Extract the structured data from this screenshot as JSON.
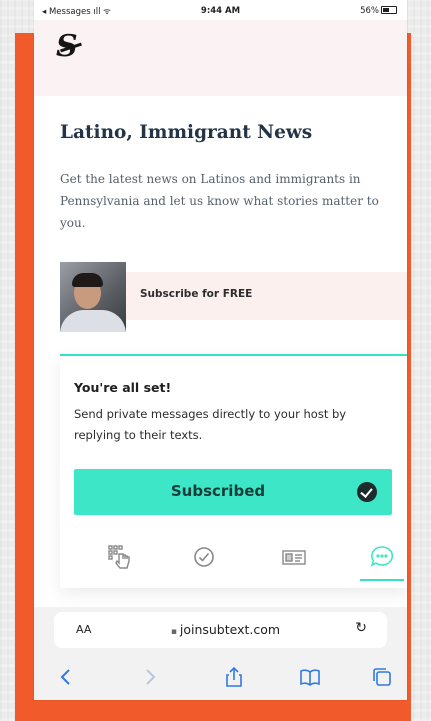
{
  "status_bar": {
    "carrier": "◂ Messages",
    "time": "9:44 AM",
    "battery": "56%"
  },
  "page": {
    "logo": "S",
    "title": "Latino, Immigrant News",
    "description": "Get the latest news on Latinos and immigrants in Pennsylvania and let us know what stories matter to you.",
    "subscribe_label": "Subscribe for FREE"
  },
  "card": {
    "title": "You're all set!",
    "text": "Send private messages directly to your host by replying to their texts.",
    "button_label": "Subscribed",
    "icons": [
      "grid-hand-icon",
      "checkmark-circle-icon",
      "id-card-icon",
      "chat-bubble-icon"
    ],
    "accent_color": "#3ce6c6"
  },
  "browser": {
    "aa_label": "AA",
    "url": "joinsubtext.com"
  },
  "colors": {
    "frame": "#f15a2a",
    "title": "#243447"
  }
}
